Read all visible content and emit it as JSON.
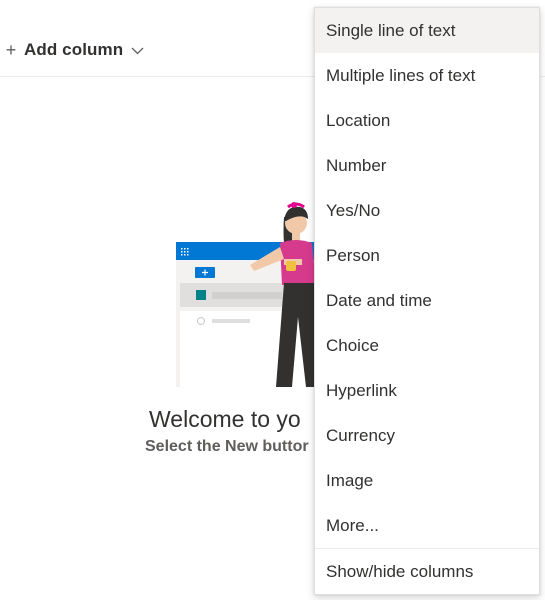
{
  "toolbar": {
    "add_column_label": "Add column",
    "plus_icon": "plus-icon",
    "chevron_icon": "chevron-down-icon"
  },
  "empty_state": {
    "title": "Welcome to yo",
    "subtitle": "Select the New buttor"
  },
  "menu": {
    "items": [
      {
        "label": "Single line of text",
        "highlighted": true
      },
      {
        "label": "Multiple lines of text"
      },
      {
        "label": "Location"
      },
      {
        "label": "Number"
      },
      {
        "label": "Yes/No"
      },
      {
        "label": "Person"
      },
      {
        "label": "Date and time"
      },
      {
        "label": "Choice"
      },
      {
        "label": "Hyperlink"
      },
      {
        "label": "Currency"
      },
      {
        "label": "Image"
      },
      {
        "label": "More..."
      }
    ],
    "footer_item": "Show/hide columns"
  },
  "colors": {
    "accent": "#0078d4",
    "shirt": "#d63a8c",
    "pants": "#323130"
  }
}
